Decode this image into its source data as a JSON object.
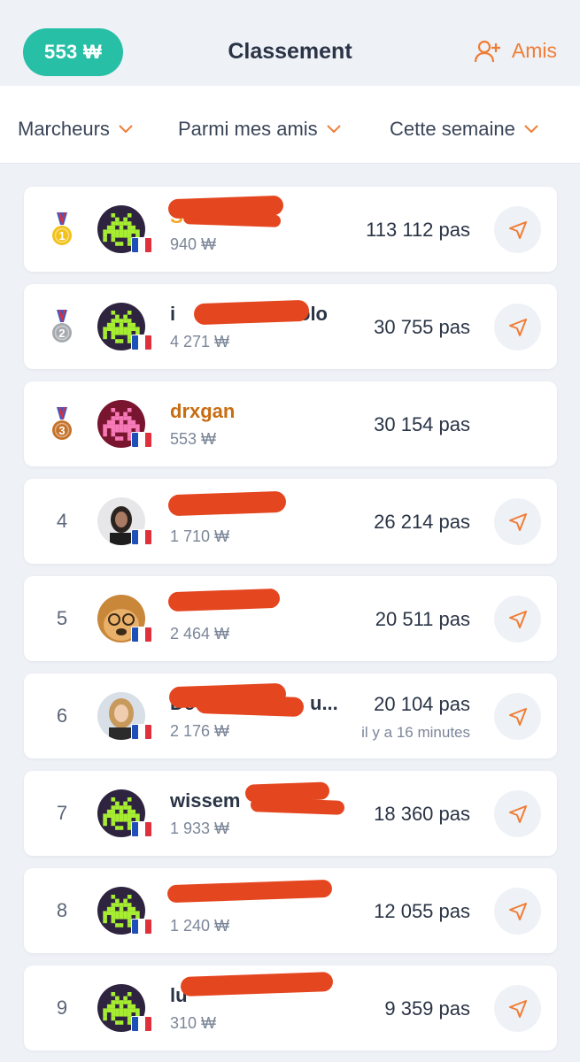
{
  "header": {
    "wallet": "553 ₩",
    "title": "Classement",
    "friends_label": "Amis"
  },
  "filters": [
    {
      "label": "Marcheurs"
    },
    {
      "label": "Parmi mes amis"
    },
    {
      "label": "Cette semaine"
    }
  ],
  "colors": {
    "accent": "#f07d35",
    "teal": "#27bfa6",
    "redaction": "#e4461f",
    "pixel_green": "#a7ee32",
    "pixel_pink": "#f67ab8"
  },
  "rows": [
    {
      "rank": "1",
      "medal": "gold",
      "name": "Su",
      "name_color": "#f5a623",
      "coins": "940 ₩",
      "steps": "113 112 pas",
      "avatar": "pixel-green"
    },
    {
      "rank": "2",
      "medal": "silver",
      "name": "i",
      "name_tail": "olo",
      "coins": "4 271 ₩",
      "steps": "30 755 pas",
      "avatar": "pixel-green"
    },
    {
      "rank": "3",
      "medal": "bronze",
      "name": "drxgan",
      "name_color": "#c76d12",
      "coins": "553 ₩",
      "steps": "30 154 pas",
      "avatar": "pixel-pink"
    },
    {
      "rank": "4",
      "name": "",
      "coins": "1 710 ₩",
      "steps": "26 214 pas",
      "avatar": "photo-person"
    },
    {
      "rank": "5",
      "name": "",
      "coins": "2 464 ₩",
      "steps": "20 511 pas",
      "avatar": "photo-dog"
    },
    {
      "rank": "6",
      "name": "De",
      "name_tail": "u...",
      "coins": "2 176 ₩",
      "steps": "20 104 pas",
      "ago": "il y a 16 minutes",
      "avatar": "photo-woman"
    },
    {
      "rank": "7",
      "name": "wissem",
      "coins": "1 933 ₩",
      "steps": "18 360 pas",
      "avatar": "pixel-green"
    },
    {
      "rank": "8",
      "name": "",
      "coins": "1 240 ₩",
      "steps": "12 055 pas",
      "avatar": "pixel-green"
    },
    {
      "rank": "9",
      "name": "lu",
      "coins": "310 ₩",
      "steps": "9 359 pas",
      "avatar": "pixel-green"
    }
  ]
}
